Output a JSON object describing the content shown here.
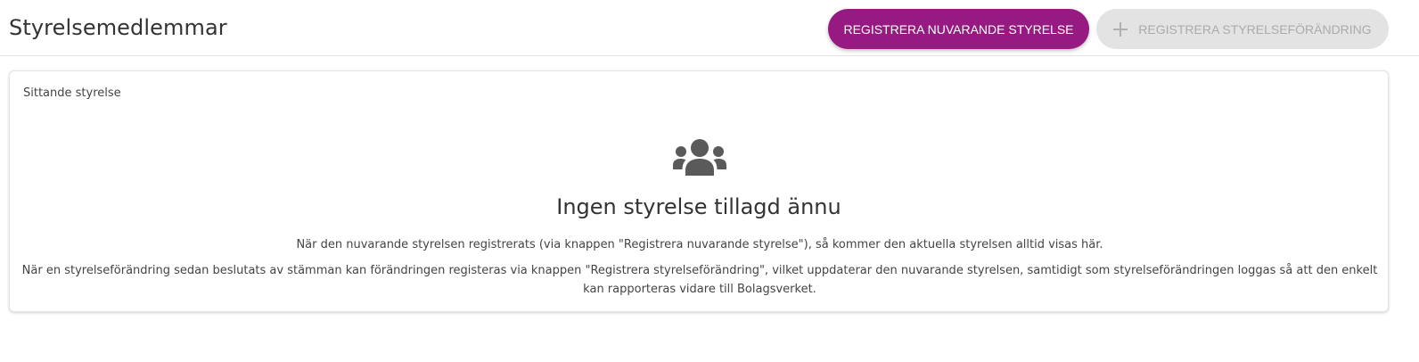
{
  "header": {
    "title": "Styrelsemedlemmar",
    "register_current_label": "REGISTRERA NUVARANDE STYRELSE",
    "register_change_label": "REGISTRERA STYRELSEFÖRÄNDRING"
  },
  "colors": {
    "accent": "#961a82",
    "disabled_bg": "#e3e3e3",
    "disabled_text": "#ababab"
  },
  "card": {
    "label": "Sittande styrelse",
    "icon": "users-group-icon",
    "empty_title": "Ingen styrelse tillagd ännu",
    "empty_text_1": "När den nuvarande styrelsen registrerats (via knappen \"Registrera nuvarande styrelse\"), så kommer den aktuella styrelsen alltid visas här.",
    "empty_text_2": "När en styrelseförändring sedan beslutats av stämman kan förändringen registeras via knappen \"Registrera styrelseförändring\", vilket uppdaterar den nuvarande styrelsen, samtidigt som styrelseförändringen loggas så att den enkelt kan rapporteras vidare till Bolagsverket."
  }
}
